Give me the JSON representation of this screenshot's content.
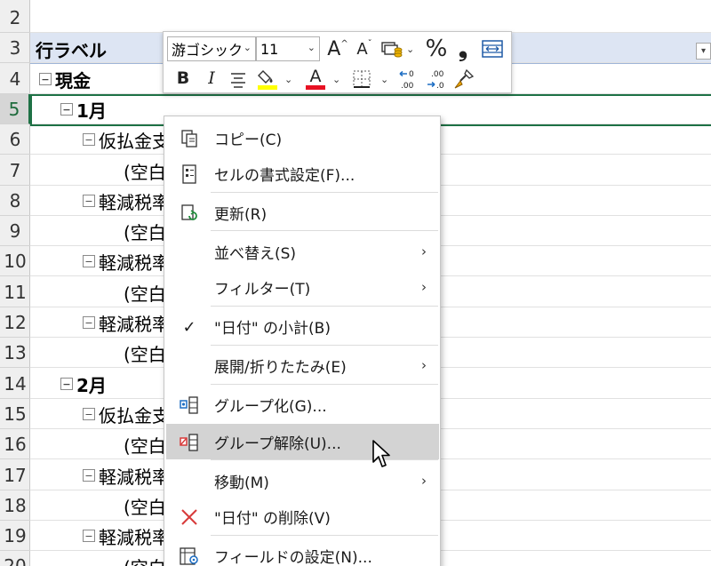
{
  "sheet": {
    "rows": [
      "2",
      "3",
      "4",
      "5",
      "6",
      "7",
      "8",
      "9",
      "10",
      "11",
      "12",
      "13",
      "14",
      "15",
      "16",
      "17",
      "18",
      "19",
      "20"
    ],
    "selected_row": "5",
    "header_label": "行ラベル",
    "filter_arrow": "▾",
    "cells": [
      {
        "row": "4",
        "text": "現金",
        "indent": 0,
        "bold": true,
        "box": "−"
      },
      {
        "row": "5",
        "text": "1月",
        "indent": 1,
        "bold": true,
        "box": "−"
      },
      {
        "row": "6",
        "text": "仮払金支",
        "indent": 2,
        "bold": false,
        "box": "−"
      },
      {
        "row": "7",
        "text": "(空白",
        "indent": 3,
        "bold": false,
        "box": ""
      },
      {
        "row": "8",
        "text": "軽減税率",
        "indent": 2,
        "bold": false,
        "box": "−"
      },
      {
        "row": "9",
        "text": "(空白",
        "indent": 3,
        "bold": false,
        "box": ""
      },
      {
        "row": "10",
        "text": "軽減税率",
        "indent": 2,
        "bold": false,
        "box": "−"
      },
      {
        "row": "11",
        "text": "(空白",
        "indent": 3,
        "bold": false,
        "box": ""
      },
      {
        "row": "12",
        "text": "軽減税率",
        "indent": 2,
        "bold": false,
        "box": "−"
      },
      {
        "row": "13",
        "text": "(空白",
        "indent": 3,
        "bold": false,
        "box": ""
      },
      {
        "row": "14",
        "text": "2月",
        "indent": 1,
        "bold": true,
        "box": "−"
      },
      {
        "row": "15",
        "text": "仮払金支",
        "indent": 2,
        "bold": false,
        "box": "−"
      },
      {
        "row": "16",
        "text": "(空白",
        "indent": 3,
        "bold": false,
        "box": ""
      },
      {
        "row": "17",
        "text": "軽減税率",
        "indent": 2,
        "bold": false,
        "box": "−"
      },
      {
        "row": "18",
        "text": "(空白",
        "indent": 3,
        "bold": false,
        "box": ""
      },
      {
        "row": "19",
        "text": "軽減税率",
        "indent": 2,
        "bold": false,
        "box": "−"
      },
      {
        "row": "20",
        "text": "(空白",
        "indent": 3,
        "bold": false,
        "box": ""
      }
    ]
  },
  "mini_toolbar": {
    "font_name": "游ゴシック",
    "font_size": "11",
    "dropdown_arrow": "⌄",
    "percent": "%",
    "comma": "❟",
    "bold": "B",
    "italic": "I",
    "font_color_letter": "A",
    "grow_font": "A",
    "shrink_font": "A",
    "fill_color": "#ffff00",
    "font_color": "#e81123"
  },
  "context_menu": {
    "items": [
      {
        "label": "コピー(C)",
        "icon": "copy-icon",
        "submenu": false
      },
      {
        "label": "セルの書式設定(F)...",
        "icon": "format-cells-icon",
        "submenu": false
      },
      {
        "label": "更新(R)",
        "icon": "refresh-icon",
        "submenu": false
      },
      {
        "label": "並べ替え(S)",
        "icon": "",
        "submenu": true
      },
      {
        "label": "フィルター(T)",
        "icon": "",
        "submenu": true
      },
      {
        "label": "\"日付\" の小計(B)",
        "icon": "checkmark-icon",
        "submenu": false
      },
      {
        "label": "展開/折りたたみ(E)",
        "icon": "",
        "submenu": true
      },
      {
        "label": "グループ化(G)...",
        "icon": "group-icon",
        "submenu": false
      },
      {
        "label": "グループ解除(U)...",
        "icon": "ungroup-icon",
        "submenu": false
      },
      {
        "label": "移動(M)",
        "icon": "",
        "submenu": true
      },
      {
        "label": "\"日付\" の削除(V)",
        "icon": "delete-x-icon",
        "submenu": false
      },
      {
        "label": "フィールドの設定(N)...",
        "icon": "field-settings-icon",
        "submenu": false
      }
    ],
    "submenu_arrow": "›",
    "checkmark": "✓"
  }
}
